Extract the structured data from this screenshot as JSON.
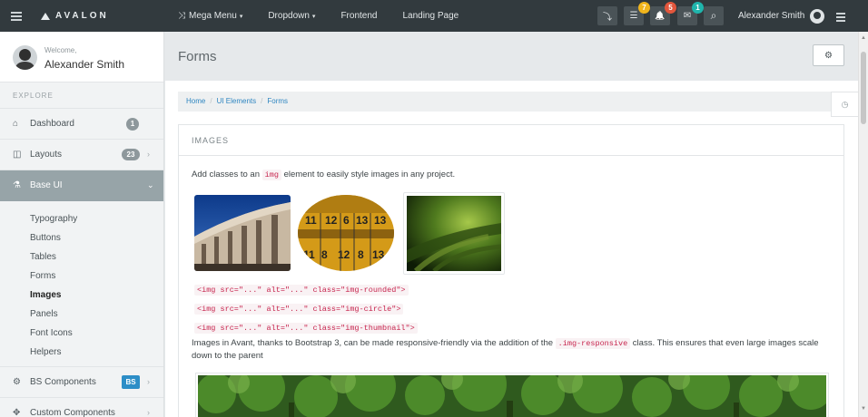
{
  "brand": {
    "name": "AVALON"
  },
  "topnav": {
    "items": [
      {
        "label": "Mega Menu",
        "icon": "shuffle-icon"
      },
      {
        "label": "Dropdown"
      },
      {
        "label": "Frontend"
      },
      {
        "label": "Landing Page"
      }
    ]
  },
  "toolbar": {
    "buttons": [
      {
        "icon": "fullscreen-icon",
        "glyph": "⤵"
      },
      {
        "icon": "list-icon",
        "glyph": "☰",
        "badge": "7",
        "badge_color": "#f1b51c"
      },
      {
        "icon": "bell-icon",
        "glyph": "🔔",
        "badge": "5",
        "badge_color": "#e2563c"
      },
      {
        "icon": "envelope-icon",
        "glyph": "✉",
        "badge": "1",
        "badge_color": "#1fb5ac"
      },
      {
        "icon": "search-icon",
        "glyph": "⌕"
      }
    ]
  },
  "user": {
    "name": "Alexander Smith",
    "welcome": "Welcome,"
  },
  "sidebar": {
    "section": "EXPLORE",
    "items": [
      {
        "label": "Dashboard",
        "icon": "home-icon",
        "badge": "1"
      },
      {
        "label": "Layouts",
        "icon": "columns-icon",
        "badge": "23"
      },
      {
        "label": "Base UI",
        "icon": "flask-icon"
      },
      {
        "label": "BS Components",
        "icon": "cogs-icon",
        "badge": "BS"
      },
      {
        "label": "Custom Components",
        "icon": "puzzle-icon"
      }
    ],
    "submenu": [
      "Typography",
      "Buttons",
      "Tables",
      "Forms",
      "Images",
      "Panels",
      "Font Icons",
      "Helpers"
    ]
  },
  "page": {
    "title": "Forms"
  },
  "breadcrumb": [
    "Home",
    "UI Elements",
    "Forms"
  ],
  "panel": {
    "heading": "IMAGES",
    "intro_before": "Add classes to an ",
    "intro_code": "img",
    "intro_after": " element to easily style images in any project.",
    "code_lines": [
      "<img src=\"...\" alt=\"...\" class=\"img-rounded\">",
      "<img src=\"...\" alt=\"...\" class=\"img-circle\">",
      "<img src=\"...\" alt=\"...\" class=\"img-thumbnail\">"
    ],
    "para_before": "Images in Avant, thanks to Bootstrap 3, can be made responsive-friendly via the addition of the ",
    "para_code": ".img-responsive",
    "para_after": " class. This ensures that even large images scale down to the parent"
  }
}
